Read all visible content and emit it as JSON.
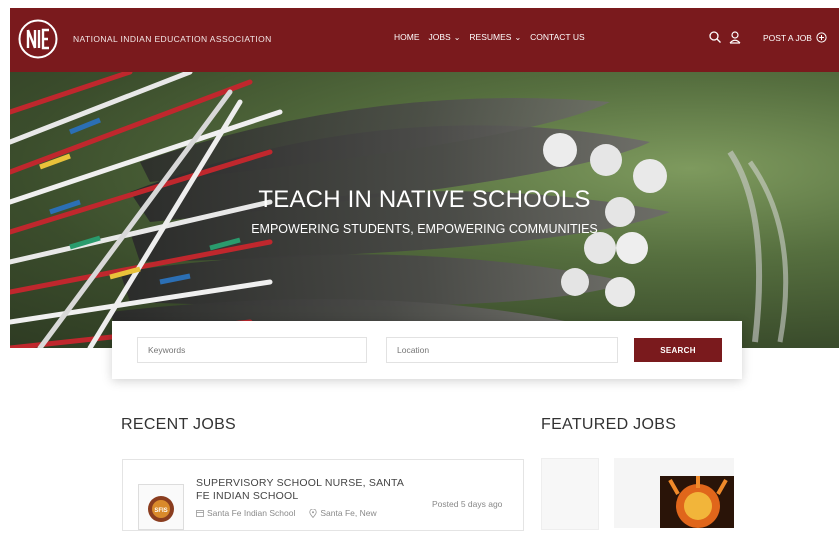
{
  "header": {
    "org_name": "NATIONAL INDIAN EDUCATION ASSOCIATION",
    "logo_icon": "niea-logo-icon",
    "nav": [
      {
        "label": "HOME",
        "dropdown": false
      },
      {
        "label": "JOBS",
        "dropdown": true
      },
      {
        "label": "RESUMES",
        "dropdown": true
      },
      {
        "label": "CONTACT US",
        "dropdown": false
      }
    ],
    "post_job_label": "POST A JOB",
    "icons": [
      "search-icon",
      "user-icon",
      "plus-circle-icon"
    ],
    "colors": {
      "brand": "#7a1a1d",
      "text": "#ffffff"
    }
  },
  "hero": {
    "title": "TEACH IN NATIVE SCHOOLS",
    "subtitle": "EMPOWERING STUDENTS, EMPOWERING COMMUNITIES"
  },
  "search": {
    "keywords_placeholder": "Keywords",
    "location_placeholder": "Location",
    "button_label": "SEARCH"
  },
  "recent_jobs": {
    "title": "RECENT JOBS",
    "items": [
      {
        "title": "SUPERVISORY SCHOOL NURSE, SANTA FE INDIAN SCHOOL",
        "company": "Santa Fe Indian School",
        "location": "Santa Fe, New",
        "posted": "Posted 5 days ago",
        "logo_text": "SFIS"
      }
    ]
  },
  "featured_jobs": {
    "title": "FEATURED JOBS"
  }
}
